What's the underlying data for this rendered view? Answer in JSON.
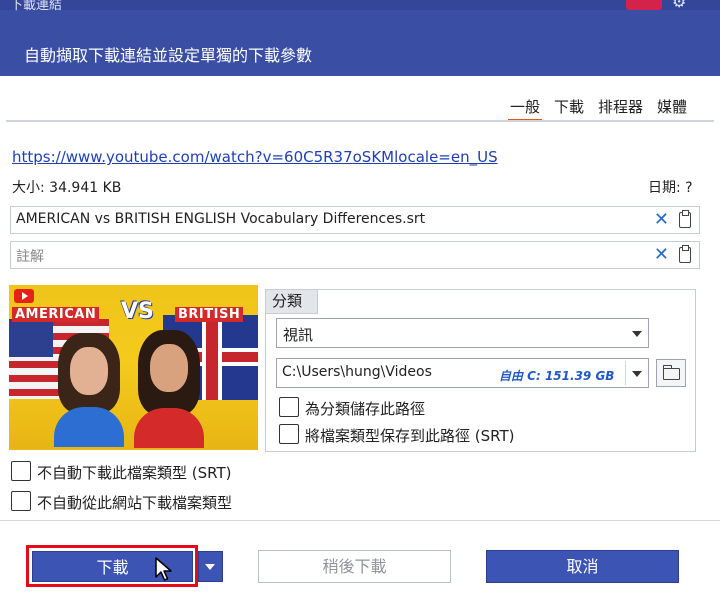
{
  "window": {
    "title_fragment": "下載連結",
    "subtitle": "自動擷取下載連結並設定單獨的下載參數"
  },
  "tabs": [
    {
      "label": "一般",
      "active": true
    },
    {
      "label": "下載",
      "active": false
    },
    {
      "label": "排程器",
      "active": false
    },
    {
      "label": "媒體",
      "active": false
    }
  ],
  "info": {
    "url": "https://www.youtube.com/watch?v=60C5R37oSKMlocale=en_US",
    "size_label": "大小: 34.941 KB",
    "date_label": "日期: ?"
  },
  "fields": {
    "filename": "AMERICAN vs BRITISH ENGLISH Vocabulary Differences.srt",
    "comment_placeholder": "註解"
  },
  "thumbnail": {
    "left_text": "AMERICAN",
    "vs_text": "VS",
    "right_text": "BRITISH"
  },
  "category": {
    "label": "分類",
    "selected": "視訊",
    "path": "C:\\Users\\hung\\Videos",
    "free_space": "自由 C: 151.39 GB",
    "save_path_for_category": "為分類儲存此路徑",
    "save_path_for_filetype": "將檔案類型保存到此路徑 (SRT)"
  },
  "options": {
    "no_auto_filetype": "不自動下載此檔案類型 (SRT)",
    "no_auto_site": "不自動從此網站下載檔案類型"
  },
  "buttons": {
    "download": "下載",
    "download_later": "稍後下載",
    "cancel": "取消"
  },
  "colors": {
    "header": "#3a4fa3",
    "primary_button": "#3c55b4",
    "tab_active": "#e9560f",
    "highlight": "#e60b18"
  }
}
